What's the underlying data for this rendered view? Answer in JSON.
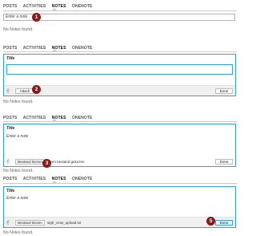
{
  "tabs": [
    "POSTS",
    "ACTIVITIES",
    "NOTES",
    "ONENOTE"
  ],
  "panel1": {
    "placeholder": "Enter a note",
    "badge": "1",
    "no_notes": "No Notes found."
  },
  "panel2": {
    "title": "Title",
    "attach_label": "Attach",
    "badge": "2",
    "done_label": "Done",
    "no_notes": "No Notes found."
  },
  "panel3": {
    "title": "Title",
    "placeholder": "Enter a note",
    "choose_label": "Bestand kiezen",
    "file_status": "Geen bestand gekozen",
    "badge": "3",
    "done_label": "Done",
    "no_notes": "No Notes found."
  },
  "panel4": {
    "title": "Title",
    "placeholder": "Enter a note",
    "choose_label": "Bestand kiezen",
    "file_status": "sigh_crow_upload.txt",
    "badge": "5",
    "done_label": "Done",
    "no_notes": "No Notes found."
  },
  "icons": {
    "attachment": "paperclip-icon"
  },
  "colors": {
    "accent": "#39a0d6",
    "badge": "#8b1a1a"
  }
}
